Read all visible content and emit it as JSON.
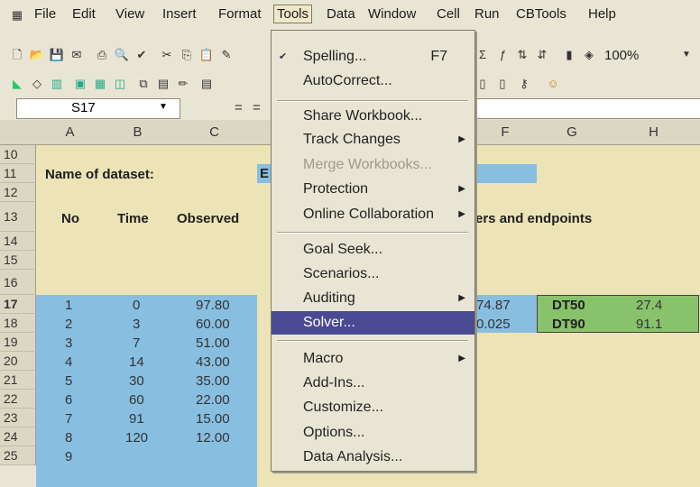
{
  "menubar": {
    "items": [
      "File",
      "Edit",
      "View",
      "Insert",
      "Format",
      "Tools",
      "Data",
      "Window",
      "Cell",
      "Run",
      "CBTools",
      "Help"
    ]
  },
  "toolbar": {
    "zoom": "100%"
  },
  "formula_bar": {
    "name_box": "S17",
    "equals": "="
  },
  "columns": [
    "A",
    "B",
    "C",
    "F",
    "G",
    "H"
  ],
  "rows": [
    "10",
    "11",
    "12",
    "13",
    "14",
    "15",
    "16",
    "17",
    "18",
    "19",
    "20",
    "21",
    "22",
    "23",
    "24",
    "25"
  ],
  "sheet": {
    "dataset_label": "Name of dataset:",
    "dataset_partial": "E",
    "headers": {
      "no": "No",
      "time": "Time",
      "observed": "Observed",
      "params_partial": "ers and endpoints"
    },
    "data": [
      {
        "no": "1",
        "time": "0",
        "obs": "97.80"
      },
      {
        "no": "2",
        "time": "3",
        "obs": "60.00"
      },
      {
        "no": "3",
        "time": "7",
        "obs": "51.00"
      },
      {
        "no": "4",
        "time": "14",
        "obs": "43.00"
      },
      {
        "no": "5",
        "time": "30",
        "obs": "35.00"
      },
      {
        "no": "6",
        "time": "60",
        "obs": "22.00"
      },
      {
        "no": "7",
        "time": "91",
        "obs": "15.00"
      },
      {
        "no": "8",
        "time": "120",
        "obs": "12.00"
      },
      {
        "no": "9",
        "time": "",
        "obs": ""
      }
    ],
    "f17": "74.87",
    "f18": "0.025",
    "g17": "DT50",
    "h17": "27.4",
    "g18": "DT90",
    "h18": "91.1"
  },
  "tools_menu": [
    {
      "label": "Spelling...",
      "shortcut": "F7"
    },
    {
      "label": "AutoCorrect..."
    },
    {
      "label": "Share Workbook..."
    },
    {
      "label": "Track Changes"
    },
    {
      "label": "Merge Workbooks..."
    },
    {
      "label": "Protection"
    },
    {
      "label": "Online Collaboration"
    },
    {
      "label": "Goal Seek..."
    },
    {
      "label": "Scenarios..."
    },
    {
      "label": "Auditing"
    },
    {
      "label": "Solver..."
    },
    {
      "label": "Macro"
    },
    {
      "label": "Add-Ins..."
    },
    {
      "label": "Customize..."
    },
    {
      "label": "Options..."
    },
    {
      "label": "Data Analysis..."
    }
  ],
  "colors": {
    "highlight": "#4a4a93",
    "blue_cells": "#88bfe1",
    "green_cells": "#88c26b"
  }
}
